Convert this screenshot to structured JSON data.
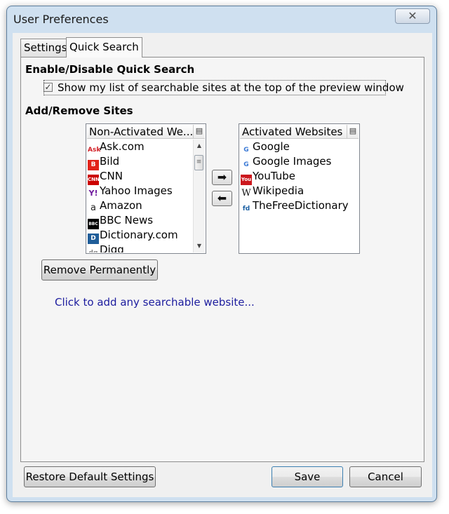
{
  "window": {
    "title": "User Preferences",
    "close_glyph": "✕"
  },
  "tabs": [
    {
      "label": "Settings",
      "active": false
    },
    {
      "label": "Quick Search",
      "active": true
    }
  ],
  "quick_search": {
    "enable_heading": "Enable/Disable Quick Search",
    "show_list_label": "Show my list of searchable sites at the top of the preview window",
    "show_list_checked": true,
    "add_remove_heading": "Add/Remove Sites",
    "non_activated": {
      "header": "Non-Activated We...",
      "items": [
        {
          "label": "Ask.com",
          "icon": "ask-icon",
          "color": "#d21f26",
          "glyph": "Ask"
        },
        {
          "label": "Bild",
          "icon": "bild-icon",
          "color": "#e2231a",
          "glyph": "B"
        },
        {
          "label": "CNN",
          "icon": "cnn-icon",
          "color": "#cc0000",
          "glyph": "CNN"
        },
        {
          "label": "Yahoo Images",
          "icon": "yahoo-icon",
          "color": "#6f1a9e",
          "glyph": "Y!"
        },
        {
          "label": "Amazon",
          "icon": "amazon-icon",
          "color": "#222222",
          "glyph": "a"
        },
        {
          "label": "BBC News",
          "icon": "bbc-icon",
          "color": "#000000",
          "glyph": "BBC"
        },
        {
          "label": "Dictionary.com",
          "icon": "dictionary-icon",
          "color": "#1f5d99",
          "glyph": "D"
        },
        {
          "label": "Digg",
          "icon": "digg-icon",
          "color": "#888888",
          "glyph": "dg"
        }
      ]
    },
    "activated": {
      "header": "Activated Websites",
      "items": [
        {
          "label": "Google",
          "icon": "google-icon",
          "color": "#3b7ad6",
          "glyph": "G"
        },
        {
          "label": "Google Images",
          "icon": "google-images-icon",
          "color": "#3b7ad6",
          "glyph": "G"
        },
        {
          "label": "YouTube",
          "icon": "youtube-icon",
          "color": "#cc181e",
          "glyph": "You"
        },
        {
          "label": "Wikipedia",
          "icon": "wikipedia-icon",
          "color": "#111111",
          "glyph": "W"
        },
        {
          "label": "TheFreeDictionary",
          "icon": "thefreedictionary-icon",
          "color": "#1a5fa3",
          "glyph": "fd"
        }
      ]
    },
    "add_arrow": "➡",
    "remove_arrow": "⬅",
    "remove_permanently": "Remove Permanently",
    "add_link": "Click to add any searchable website..."
  },
  "footer": {
    "restore_defaults": "Restore Default Settings",
    "save": "Save",
    "cancel": "Cancel"
  },
  "colors": {
    "link": "#1c1c9e",
    "button_border_focus": "#3c7fb1",
    "window_frame": "#cfe0f0"
  }
}
